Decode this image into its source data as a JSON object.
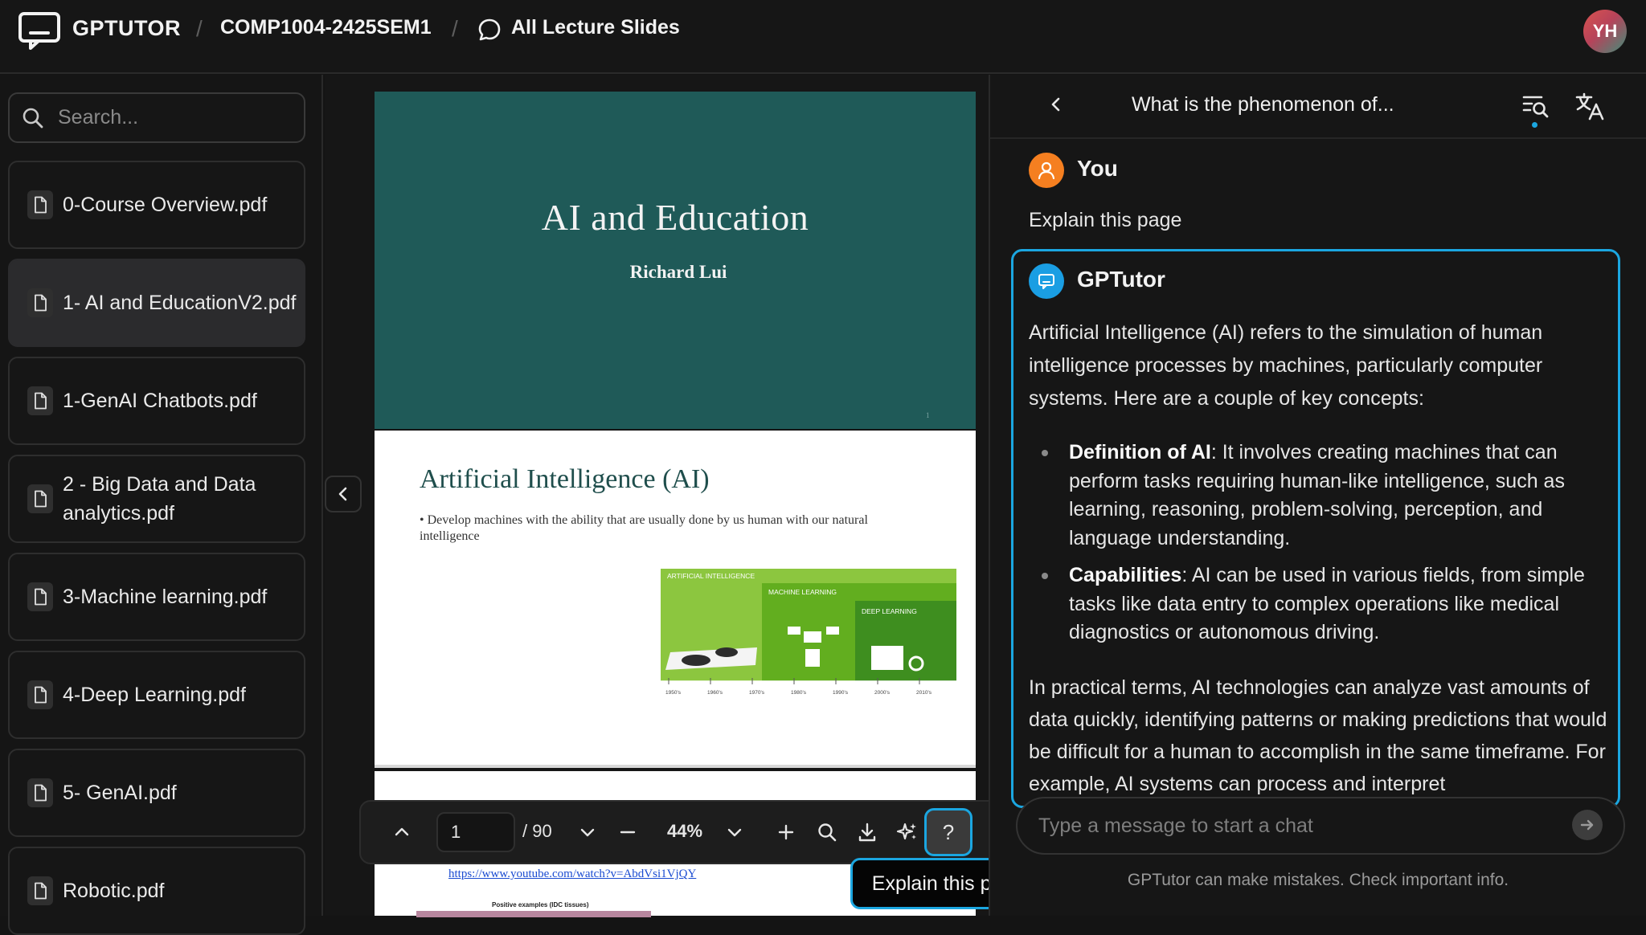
{
  "header": {
    "app_name": "GPTUTOR",
    "separator": "/",
    "course": "COMP1004-2425SEM1",
    "section": "All Lecture Slides",
    "avatar_initials": "YH"
  },
  "sidebar": {
    "search_placeholder": "Search...",
    "files": [
      {
        "name": "0-Course Overview.pdf"
      },
      {
        "name": "1- AI and EducationV2.pdf",
        "active": true
      },
      {
        "name": "1-GenAI Chatbots.pdf"
      },
      {
        "name": "2 - Big Data and Data analytics.pdf"
      },
      {
        "name": "3-Machine learning.pdf"
      },
      {
        "name": "4-Deep Learning.pdf"
      },
      {
        "name": "5- GenAI.pdf"
      },
      {
        "name": "Robotic.pdf"
      }
    ]
  },
  "viewer": {
    "slide1": {
      "title": "AI and Education",
      "author": "Richard Lui",
      "page_num": "1"
    },
    "slide2": {
      "title": "Artificial Intelligence (AI)",
      "bullet": "Develop machines with the ability that are usually done by us human with our natural intelligence",
      "diagram_labels": [
        "ARTIFICIAL INTELLIGENCE",
        "MACHINE LEARNING",
        "DEEP LEARNING"
      ],
      "timeline": [
        "1950's",
        "1960's",
        "1970's",
        "1980's",
        "1990's",
        "2000's",
        "2010's"
      ]
    },
    "slide3": {
      "link": "https://www.youtube.com/watch?v=AbdVsi1VjQY",
      "caption": "Positive examples (IDC tissues)"
    },
    "toolbar": {
      "page_value": "1",
      "page_total": "/ 90",
      "zoom": "44%",
      "explain_label": "?",
      "tooltip": "Explain this page"
    }
  },
  "chat": {
    "title": "What is the phenomenon of...",
    "user_name": "You",
    "user_message": "Explain this page",
    "bot_name": "GPTutor",
    "bot_intro": "Artificial Intelligence (AI) refers to the simulation of human intelligence processes by machines, particularly computer systems. Here are a couple of key concepts:",
    "bullets": [
      {
        "term": "Definition of AI",
        "text": ": It involves creating machines that can perform tasks requiring human-like intelligence, such as learning, reasoning, problem-solving, perception, and language understanding."
      },
      {
        "term": "Capabilities",
        "text": ": AI can be used in various fields, from simple tasks like data entry to complex operations like medical diagnostics or autonomous driving."
      }
    ],
    "bot_outro": "In practical terms, AI technologies can analyze vast amounts of data quickly, identifying patterns or making predictions that would be difficult for a human to accomplish in the same timeframe. For example, AI systems can process and interpret",
    "input_placeholder": "Type a message to start a chat",
    "disclaimer": "GPTutor can make mistakes. Check important info."
  },
  "colors": {
    "accent": "#1ba6e0",
    "slide_teal": "#1f5a58",
    "user_avatar": "#f57f20",
    "bot_avatar": "#1a9ee3"
  },
  "icons": [
    "chat-window-logo-icon",
    "chat-bubble-icon",
    "search-icon",
    "file-icon",
    "chevron-left-icon",
    "chevron-up-icon",
    "chevron-down-icon",
    "minus-icon",
    "plus-icon",
    "zoom-search-icon",
    "download-icon",
    "sparkle-icon",
    "question-icon",
    "history-search-icon",
    "translate-icon",
    "person-icon",
    "bot-chat-icon",
    "arrow-right-icon"
  ]
}
